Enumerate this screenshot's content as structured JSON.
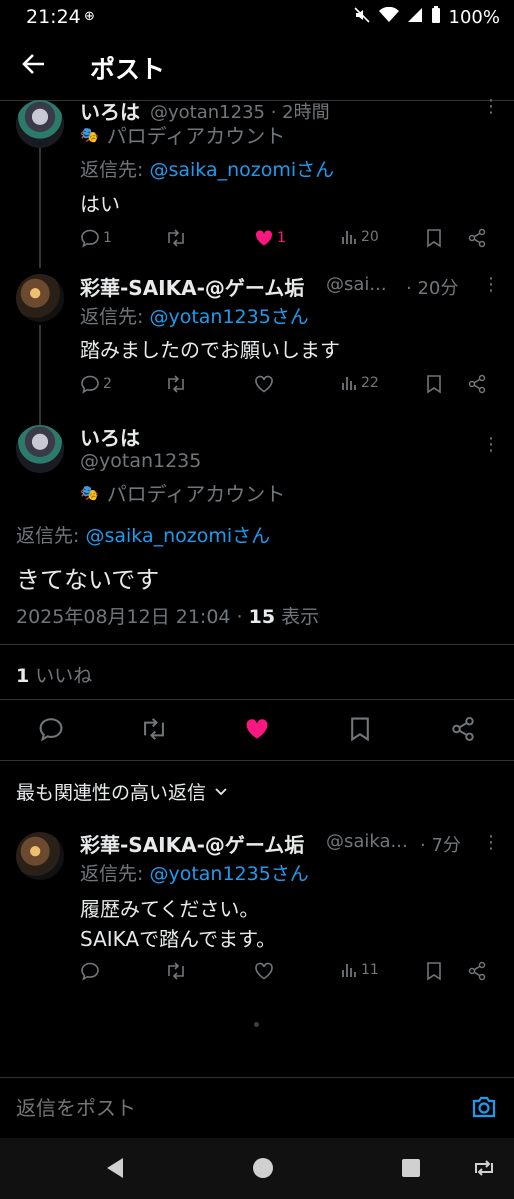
{
  "status_bar": {
    "time": "21:24",
    "battery": "100%"
  },
  "header": {
    "title": "ポスト"
  },
  "reply1": {
    "name": "いろは",
    "handle": "@yotan1235 · 2時間",
    "parody": "パロディアカウント",
    "reply_prefix": "返信先: ",
    "reply_target": "@saika_nozomiさん",
    "text": "はい",
    "replies": "1",
    "likes": "1",
    "views": "20"
  },
  "reply2": {
    "name": "彩華-SAIKA-@ゲーム垢",
    "handle": "@sai...",
    "time": "· 20分",
    "reply_prefix": "返信先: ",
    "reply_target": "@yotan1235さん",
    "text": "踏みましたのでお願いします",
    "replies": "2",
    "views": "22"
  },
  "main_post": {
    "name": "いろは",
    "handle": "@yotan1235",
    "parody": "パロディアカウント",
    "reply_prefix": "返信先: ",
    "reply_target": "@saika_nozomiさん",
    "text": "きてないです",
    "date": "2025年08月12日 21:04 · ",
    "views_count": "15",
    "views_label": " 表示",
    "likes_count": "1",
    "likes_label": " いいね"
  },
  "sort": {
    "label": "最も関連性の高い返信"
  },
  "reply3": {
    "name": "彩華-SAIKA-@ゲーム垢",
    "handle": "@saika...",
    "time": "· 7分",
    "reply_prefix": "返信先: ",
    "reply_target": "@yotan1235さん",
    "text_line1": "履歴みてください。",
    "text_line2": "SAIKAで踏んでます。",
    "views": "11"
  },
  "composer": {
    "placeholder": "返信をポスト"
  },
  "colors": {
    "like": "#f91880",
    "link": "#1d9bf0",
    "muted": "#71767b"
  }
}
